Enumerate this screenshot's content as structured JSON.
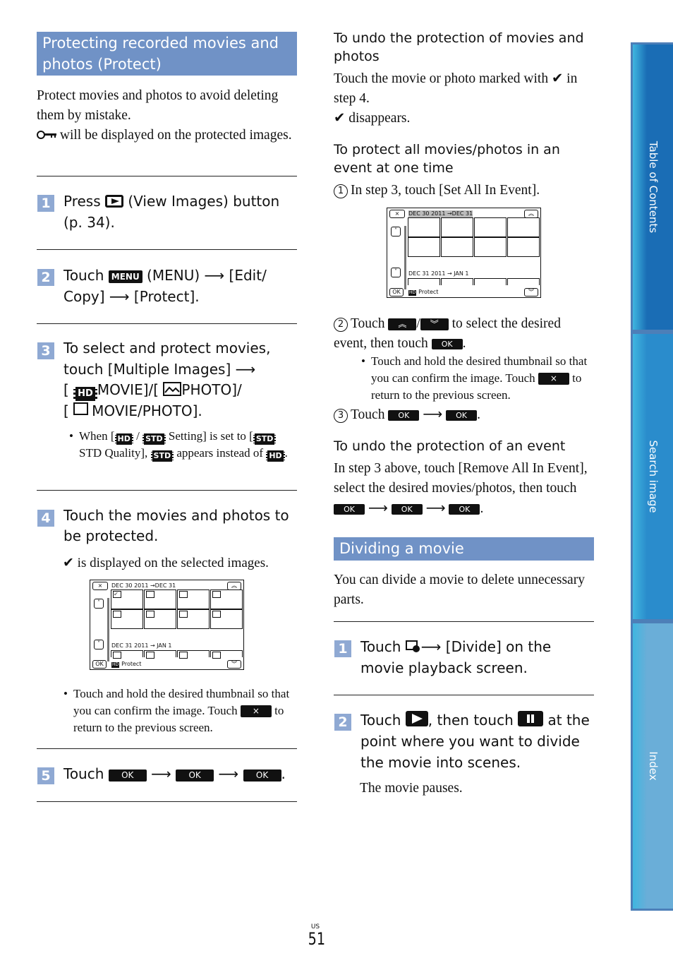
{
  "left": {
    "section_title": "Protecting recorded movies and photos (Protect)",
    "intro": "Protect movies and photos to avoid deleting them by mistake.",
    "intro_key_icon": "key-icon",
    "intro_key_text": " will be displayed on the protected images.",
    "steps": [
      {
        "num": "1",
        "prefix": "Press ",
        "icon": "view-images-icon",
        "suffix": " (View Images) button (p. 34)."
      },
      {
        "num": "2",
        "prefix": "Touch ",
        "menu_label": "MENU",
        "suffix_a": " (MENU) ",
        "arrow": "→",
        "suffix_b": " [Edit/ Copy] ",
        "suffix_c": " [Protect]."
      },
      {
        "num": "3",
        "line1": "To select and protect movies, touch [Multiple Images] ",
        "hd_label": "HD",
        "movie": "MOVIE]/[",
        "photo": "PHOTO]/",
        "moviephoto": "MOVIE/PHOTO].",
        "bullet": {
          "a": "When [",
          "b": " / ",
          "c": " Setting] is set to [",
          "d": " STD Quality], ",
          "e": " appears instead of ",
          "f": ".",
          "std_label": "STD"
        }
      },
      {
        "num": "4",
        "text": "Touch the movies and photos to be protected.",
        "note": " is displayed on the selected images."
      },
      {
        "num": "5",
        "prefix": "Touch ",
        "ok": "OK",
        "end": "."
      }
    ],
    "screen": {
      "close": "×",
      "date1": "DEC 30 2011 →DEC 31",
      "date2": "DEC 31 2011 → JAN 1",
      "ok": "OK",
      "footer": "Protect",
      "hd": "HD",
      "up": "˄",
      "down": "˅",
      "up2": "︽",
      "down2": "︾",
      "checked_index": 0
    },
    "bullet_hold": {
      "text": "Touch and hold the desired thumbnail so that you can confirm the image. Touch ",
      "btn": "×",
      "after": " to return to the previous screen."
    }
  },
  "right": {
    "undo_title": "To undo the protection of movies and photos",
    "undo_text_a": "Touch the movie or photo marked with ",
    "undo_text_b": " in step 4.",
    "undo_text_c": " disappears.",
    "event_title": "To protect all movies/photos in an event at one time",
    "event_step1": "In step 3, touch [Set All In Event].",
    "event_step2_a": "Touch ",
    "event_step2_b": " to select the desired event, then touch ",
    "event_bullet": "Touch and hold the desired thumbnail so that you can confirm the image. Touch ",
    "event_bullet_after": " to return to the previous screen.",
    "event_step3": "Touch ",
    "circled": [
      "1",
      "2",
      "3"
    ],
    "undo_event_title": "To undo the protection of an event",
    "undo_event_text": "In step 3 above, touch [Remove All In Event], select the desired movies/photos, then touch ",
    "divide_title": "Dividing a movie",
    "divide_intro": "You can divide a movie to delete unnecessary parts.",
    "divide_steps": [
      {
        "num": "1",
        "prefix": "Touch ",
        "suffix": " [Divide] on the movie playback screen."
      },
      {
        "num": "2",
        "prefix": "Touch ",
        "mid": ", then touch ",
        "suffix": " at the point where you want to divide the movie into scenes.",
        "note": "The movie pauses."
      }
    ],
    "screen": {
      "close": "×",
      "date1": "DEC 30 2011 →DEC 31",
      "date2": "DEC 31 2011 → JAN 1",
      "ok": "OK",
      "footer": "Protect",
      "hd": "HD"
    }
  },
  "side_nav": [
    {
      "label": "Table of Contents",
      "color": "#1a6db5"
    },
    {
      "label": "Search image",
      "color": "#2a8ccc"
    },
    {
      "label": "Index",
      "color": "#6aaed8"
    }
  ],
  "footer": {
    "region": "US",
    "page": "51"
  },
  "icons": {
    "check": "✔",
    "arrow": "⟶",
    "ok": "OK",
    "x": "×"
  }
}
